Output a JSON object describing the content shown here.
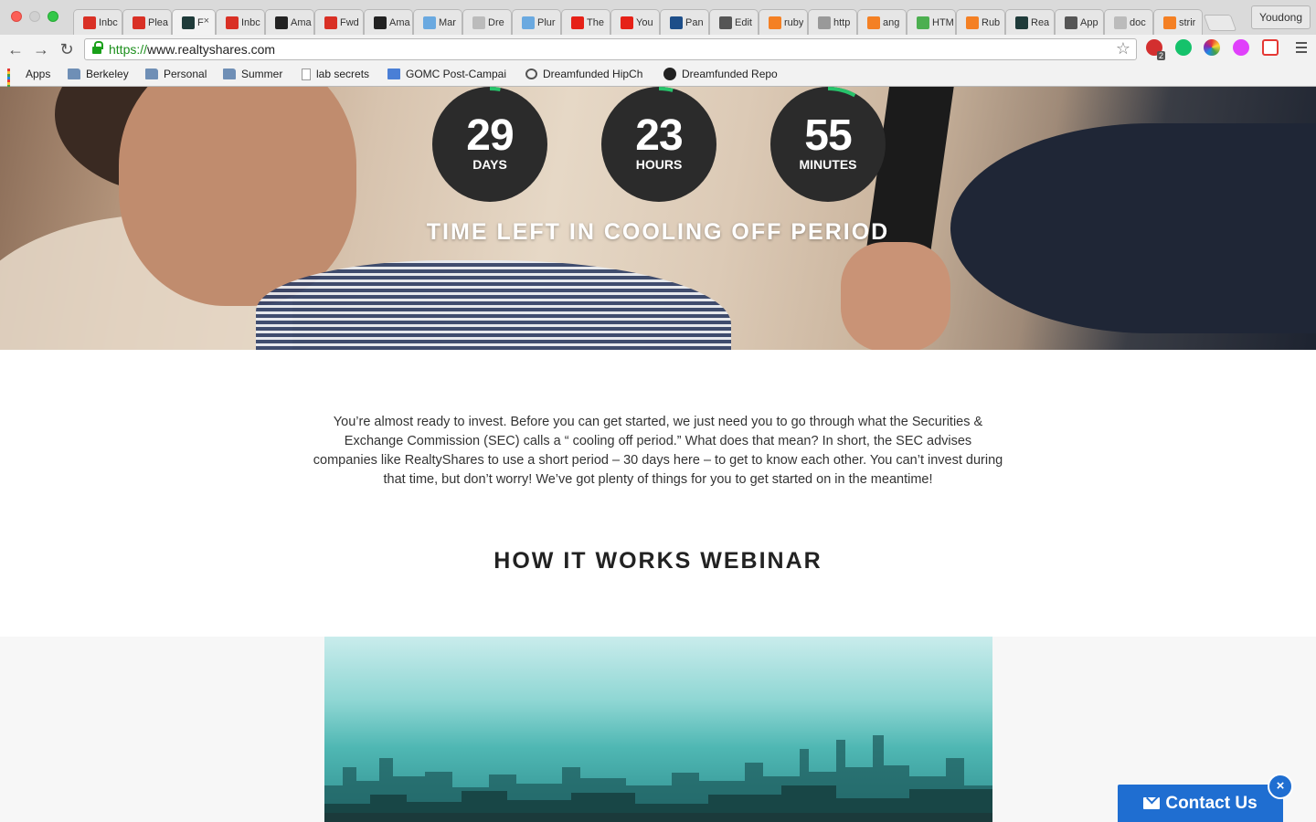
{
  "browser": {
    "tabs": [
      {
        "title": "Inbc",
        "favicon": "gmail-icon",
        "color": "#d93025"
      },
      {
        "title": "Plea",
        "favicon": "gmail-icon",
        "color": "#d93025"
      },
      {
        "title": "F",
        "favicon": "realtyshares-icon",
        "color": "#1f3b3a",
        "active": true
      },
      {
        "title": "Inbc",
        "favicon": "gmail-icon",
        "color": "#d93025"
      },
      {
        "title": "Ama",
        "favicon": "amazon-icon",
        "color": "#222222"
      },
      {
        "title": "Fwd",
        "favicon": "gmail-icon",
        "color": "#d93025"
      },
      {
        "title": "Ama",
        "favicon": "amazon-icon",
        "color": "#222222"
      },
      {
        "title": "Mar",
        "favicon": "page-icon",
        "color": "#6aa9e0"
      },
      {
        "title": "Dre",
        "favicon": "doc-icon",
        "color": "#bbbbbb"
      },
      {
        "title": "Plur",
        "favicon": "plur-icon",
        "color": "#6aa9e0"
      },
      {
        "title": "The",
        "favicon": "youtube-icon",
        "color": "#e62117"
      },
      {
        "title": "You",
        "favicon": "youtube-icon",
        "color": "#e62117"
      },
      {
        "title": "Pan",
        "favicon": "p-icon",
        "color": "#1d4e89"
      },
      {
        "title": "Edit",
        "favicon": "cloud-icon",
        "color": "#555555"
      },
      {
        "title": "ruby",
        "favicon": "stack-icon",
        "color": "#f48024"
      },
      {
        "title": "http",
        "favicon": "generic-icon",
        "color": "#999999"
      },
      {
        "title": "ang",
        "favicon": "stack-icon",
        "color": "#f48024"
      },
      {
        "title": "HTM",
        "favicon": "w3-icon",
        "color": "#4caf50"
      },
      {
        "title": "Rub",
        "favicon": "stack-icon",
        "color": "#f48024"
      },
      {
        "title": "Rea",
        "favicon": "realtyshares-icon",
        "color": "#1f3b3a"
      },
      {
        "title": "App",
        "favicon": "plane-icon",
        "color": "#555555"
      },
      {
        "title": "doc",
        "favicon": "doc-icon",
        "color": "#bbbbbb"
      },
      {
        "title": "strir",
        "favicon": "stack-icon",
        "color": "#f48024"
      }
    ],
    "profile_name": "Youdong",
    "url_scheme": "https://",
    "url_host": "www.realtyshares.com",
    "extension_badge": "2",
    "bookmarks": [
      {
        "label": "Apps",
        "icon": "apps-grid-icon"
      },
      {
        "label": "Berkeley",
        "icon": "folder-icon"
      },
      {
        "label": "Personal",
        "icon": "folder-icon"
      },
      {
        "label": "Summer",
        "icon": "folder-icon"
      },
      {
        "label": "lab secrets",
        "icon": "page-icon"
      },
      {
        "label": "GOMC Post-Campai",
        "icon": "doc-icon"
      },
      {
        "label": "Dreamfunded HipCh",
        "icon": "chat-icon"
      },
      {
        "label": "Dreamfunded Repo",
        "icon": "github-icon"
      }
    ]
  },
  "countdown": {
    "days": {
      "value": "29",
      "label": "DAYS",
      "progress": 0.03
    },
    "hours": {
      "value": "23",
      "label": "HOURS",
      "progress": 0.04
    },
    "minutes": {
      "value": "55",
      "label": "MINUTES",
      "progress": 0.08
    },
    "caption": "TIME LEFT IN COOLING OFF PERIOD",
    "accent_color": "#27c36b"
  },
  "intro_text": "You’re almost ready to invest. Before you can get started, we just need you to go through what the Securities & Exchange Commission (SEC) calls a “ cooling off period.” What does that mean? In short, the SEC advises companies like RealtyShares to use a short period – 30 days here – to get to know each other. You can’t invest during that time, but don’t worry! We’ve got plenty of things for you to get started on in the meantime!",
  "webinar_title": "HOW IT WORKS WEBINAR",
  "contact": {
    "label": "Contact Us",
    "close_symbol": "×",
    "color": "#1f6ed1"
  }
}
